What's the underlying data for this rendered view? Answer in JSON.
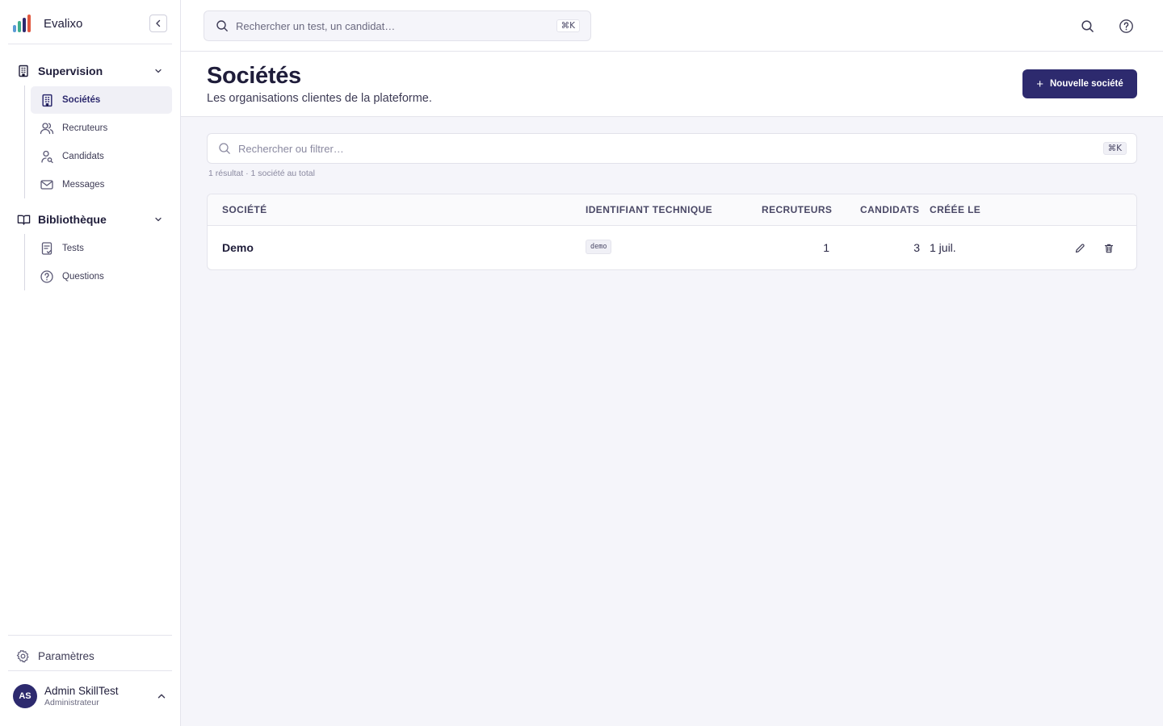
{
  "app": {
    "name": "Evalixo"
  },
  "colors": {
    "brand": "#2d2a6e",
    "logo_bars": [
      "#5b9bd5",
      "#3fae8c",
      "#2d2a6e",
      "#e0573e"
    ]
  },
  "sidebar": {
    "groups": [
      {
        "label": "Supervision",
        "icon": "building-icon",
        "items": [
          {
            "label": "Sociétés",
            "icon": "building-icon",
            "active": true
          },
          {
            "label": "Recruteurs",
            "icon": "users-icon",
            "active": false
          },
          {
            "label": "Candidats",
            "icon": "user-search-icon",
            "active": false
          },
          {
            "label": "Messages",
            "icon": "mail-icon",
            "active": false
          }
        ]
      },
      {
        "label": "Bibliothèque",
        "icon": "book-icon",
        "items": [
          {
            "label": "Tests",
            "icon": "clipboard-check-icon",
            "active": false
          },
          {
            "label": "Questions",
            "icon": "help-circle-icon",
            "active": false
          }
        ]
      }
    ],
    "settings_label": "Paramètres",
    "user": {
      "initials": "AS",
      "name": "Admin SkillTest",
      "role": "Administrateur"
    }
  },
  "topbar": {
    "search_placeholder": "Rechercher un test, un candidat…",
    "shortcut": "⌘K"
  },
  "page": {
    "title": "Sociétés",
    "subtitle": "Les organisations clientes de la plateforme.",
    "new_button_label": "Nouvelle société"
  },
  "filter": {
    "placeholder": "Rechercher ou filtrer…",
    "shortcut": "⌘K",
    "result_summary": "1 résultat · 1 société au total"
  },
  "table": {
    "columns": [
      "SOCIÉTÉ",
      "IDENTIFIANT TECHNIQUE",
      "RECRUTEURS",
      "CANDIDATS",
      "CRÉÉE LE"
    ],
    "rows": [
      {
        "company": "Demo",
        "slug": "demo",
        "recruiters": "1",
        "candidates": "3",
        "created": "1 juil."
      }
    ]
  }
}
